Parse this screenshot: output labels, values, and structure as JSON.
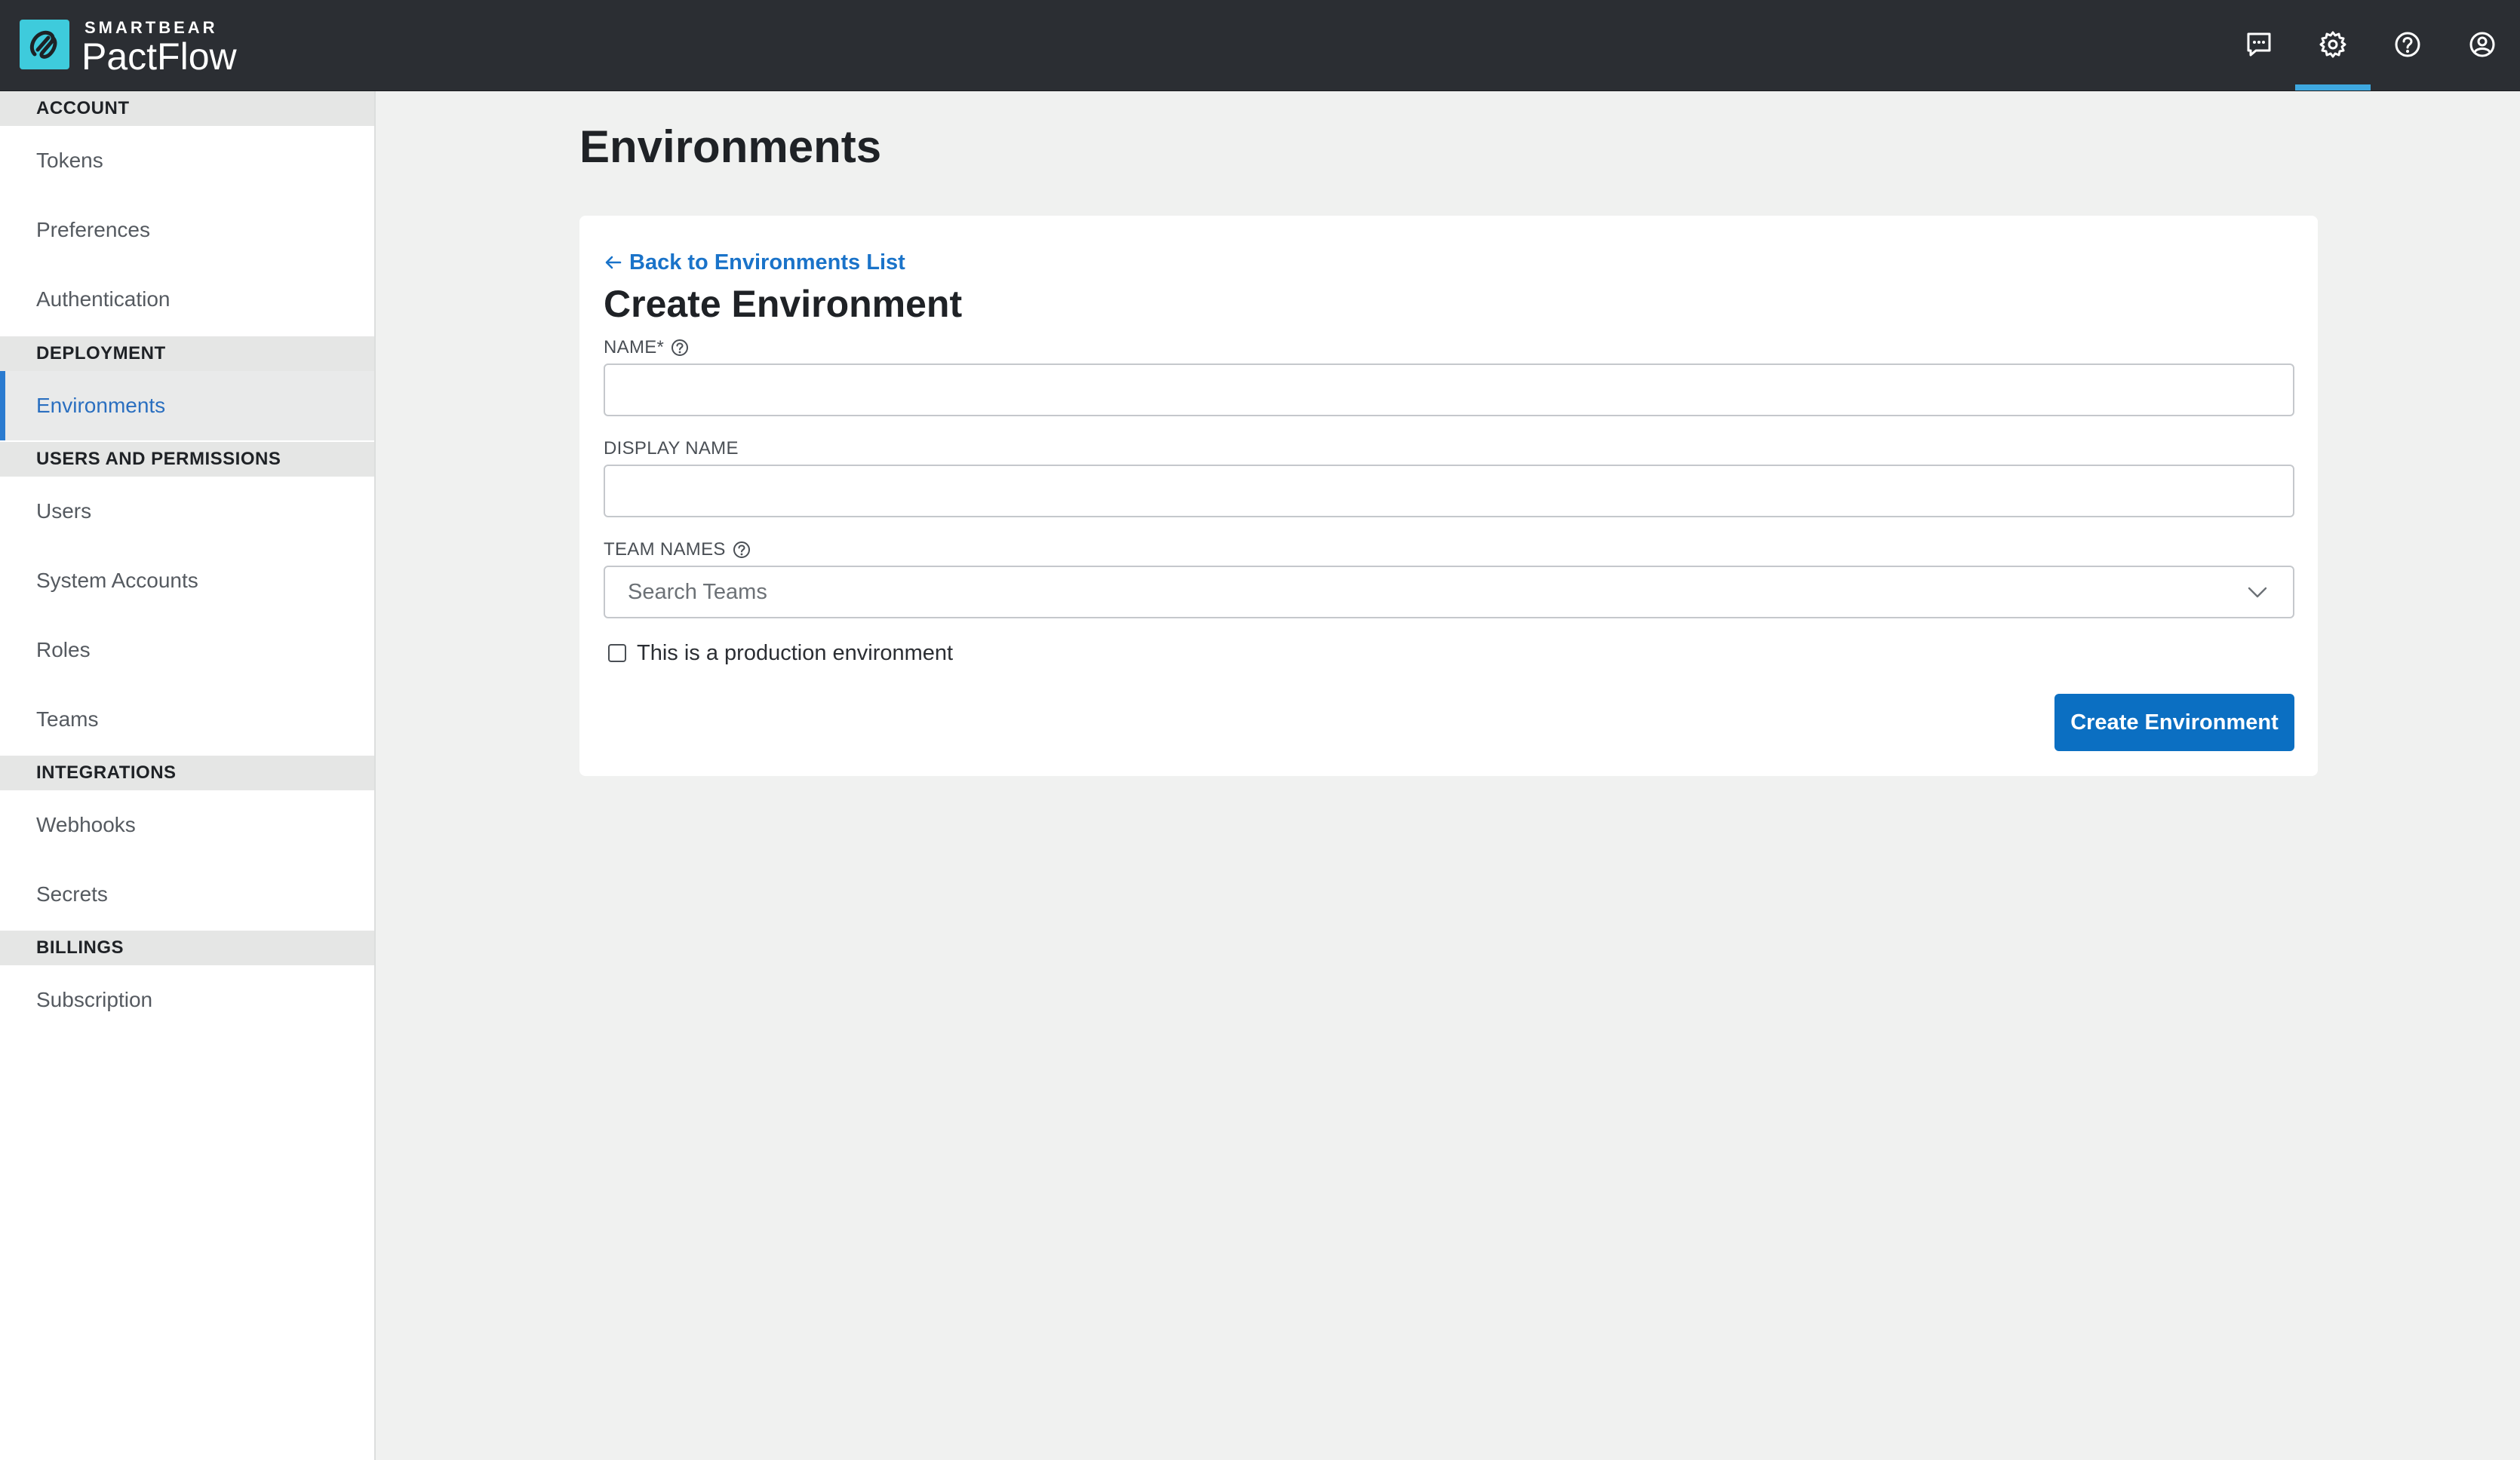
{
  "app": {
    "brand_top": "SMARTBEAR",
    "brand_name": "PactFlow"
  },
  "topbar": {
    "icons": [
      "chat-icon",
      "gear-icon",
      "help-circle-icon",
      "user-account-icon"
    ],
    "active": "gear-icon",
    "accent_color": "#3ea8e0"
  },
  "sidebar": {
    "sections": [
      {
        "heading": "ACCOUNT",
        "items": [
          "Tokens",
          "Preferences",
          "Authentication"
        ]
      },
      {
        "heading": "DEPLOYMENT",
        "items": [
          "Environments"
        ]
      },
      {
        "heading": "USERS AND PERMISSIONS",
        "items": [
          "Users",
          "System Accounts",
          "Roles",
          "Teams"
        ]
      },
      {
        "heading": "INTEGRATIONS",
        "items": [
          "Webhooks",
          "Secrets"
        ]
      },
      {
        "heading": "BILLINGS",
        "items": [
          "Subscription"
        ]
      }
    ],
    "active_item": "Environments"
  },
  "page": {
    "title": "Environments"
  },
  "form": {
    "back_link": "Back to Environments List",
    "title": "Create Environment",
    "name_label": "NAME*",
    "name_value": "",
    "display_name_label": "DISPLAY NAME",
    "display_name_value": "",
    "team_names_label": "TEAM NAMES",
    "team_names_placeholder": "Search Teams",
    "production_checkbox_label": "This is a production environment",
    "production_checked": false,
    "submit_label": "Create Environment",
    "primary_color": "#0b6fc2"
  }
}
